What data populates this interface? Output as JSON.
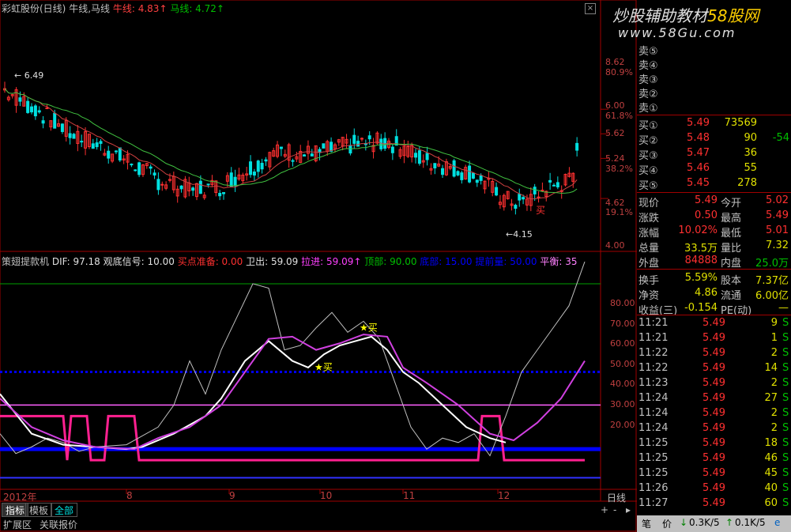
{
  "header": {
    "title": "彩虹股份(日线)",
    "ma_label": "牛线,马线",
    "niu_label": "牛线: 4.83",
    "ma_value": "马线: 4.72",
    "up_arrow": "↑",
    "watermark_cn": "炒股辅助教材",
    "watermark_site": "58股网",
    "watermark_url": "www.58Gu.com"
  },
  "price_axis": {
    "labels": [
      "8.62",
      "80.9%",
      "6.00",
      "61.8%",
      "5.62",
      "5.24",
      "38.2%",
      "4.62",
      "19.1%",
      "4.00"
    ],
    "high_annot": "6.49",
    "low_annot": "4.15",
    "buy_marker": "买"
  },
  "indicator": {
    "name": "策翅提款机",
    "dif": "DIF: 97.18",
    "signal": "观底信号: 10.00",
    "prep": "买点准备: 0.00",
    "exit": "卫出: 59.09",
    "ramp": "拉进: 59.09",
    "top": "顶部: 90.00",
    "bottom": "底部: 15.00",
    "advance": "提前量: 50.00",
    "flat": "平衡: 35",
    "axis": [
      "80.00",
      "70.00",
      "60.00",
      "50.00",
      "40.00",
      "30.00",
      "20.00"
    ],
    "buy1": "★买",
    "buy2": "★买"
  },
  "x_axis": [
    "2012年",
    "8",
    "9",
    "10",
    "11",
    "12"
  ],
  "period_label": "日线",
  "tabs": [
    "指标",
    "模板",
    "全部"
  ],
  "status_left": [
    "扩展区",
    "关联报价"
  ],
  "quotes": {
    "sells": [
      {
        "label": "卖⑤",
        "price": "",
        "vol": ""
      },
      {
        "label": "卖④",
        "price": "",
        "vol": ""
      },
      {
        "label": "卖③",
        "price": "",
        "vol": ""
      },
      {
        "label": "卖②",
        "price": "",
        "vol": ""
      },
      {
        "label": "卖①",
        "price": "",
        "vol": ""
      }
    ],
    "buys": [
      {
        "label": "买①",
        "price": "5.49",
        "vol": "73569",
        "chg": ""
      },
      {
        "label": "买②",
        "price": "5.48",
        "vol": "90",
        "chg": "-54"
      },
      {
        "label": "买③",
        "price": "5.47",
        "vol": "36",
        "chg": ""
      },
      {
        "label": "买④",
        "price": "5.46",
        "vol": "55",
        "chg": ""
      },
      {
        "label": "买⑤",
        "price": "5.45",
        "vol": "278",
        "chg": ""
      }
    ]
  },
  "stats": [
    {
      "l1": "现价",
      "v1": "5.49",
      "l2": "今开",
      "v2": "5.02"
    },
    {
      "l1": "涨跌",
      "v1": "0.50",
      "l2": "最高",
      "v2": "5.49"
    },
    {
      "l1": "涨幅",
      "v1": "10.02%",
      "l2": "最低",
      "v2": "5.01"
    },
    {
      "l1": "总量",
      "v1": "33.5万",
      "l2": "量比",
      "v2": "7.32"
    },
    {
      "l1": "外盘",
      "v1": "84888",
      "l2": "内盘",
      "v2": "25.0万"
    }
  ],
  "stats2": [
    {
      "l1": "换手",
      "v1": "5.59%",
      "l2": "股本",
      "v2": "7.37亿"
    },
    {
      "l1": "净资",
      "v1": "4.86",
      "l2": "流通",
      "v2": "6.00亿"
    },
    {
      "l1": "收益(三)",
      "v1": "-0.154",
      "l2": "PE(动)",
      "v2": "—"
    }
  ],
  "ticks": [
    {
      "t": "11:21",
      "p": "5.49",
      "v": "9",
      "s": "S"
    },
    {
      "t": "11:21",
      "p": "5.49",
      "v": "1",
      "s": "S"
    },
    {
      "t": "11:22",
      "p": "5.49",
      "v": "2",
      "s": "S"
    },
    {
      "t": "11:22",
      "p": "5.49",
      "v": "14",
      "s": "S"
    },
    {
      "t": "11:23",
      "p": "5.49",
      "v": "2",
      "s": "S"
    },
    {
      "t": "11:24",
      "p": "5.49",
      "v": "27",
      "s": "S"
    },
    {
      "t": "11:24",
      "p": "5.49",
      "v": "2",
      "s": "S"
    },
    {
      "t": "11:24",
      "p": "5.49",
      "v": "2",
      "s": "S"
    },
    {
      "t": "11:25",
      "p": "5.49",
      "v": "18",
      "s": "S"
    },
    {
      "t": "11:25",
      "p": "5.49",
      "v": "46",
      "s": "S"
    },
    {
      "t": "11:25",
      "p": "5.49",
      "v": "45",
      "s": "S"
    },
    {
      "t": "11:26",
      "p": "5.49",
      "v": "40",
      "s": "S"
    },
    {
      "t": "11:27",
      "p": "5.49",
      "v": "60",
      "s": "S"
    }
  ],
  "status_right": {
    "btn1": "笔",
    "btn2": "价",
    "down": "0.3K/5",
    "up": "0.1K/5"
  },
  "colors": {
    "up": "#ff3030",
    "down": "#00e0e0",
    "yellow": "#e8e800",
    "green": "#00c000",
    "magenta": "#ff40ff",
    "blue": "#0000ff"
  }
}
